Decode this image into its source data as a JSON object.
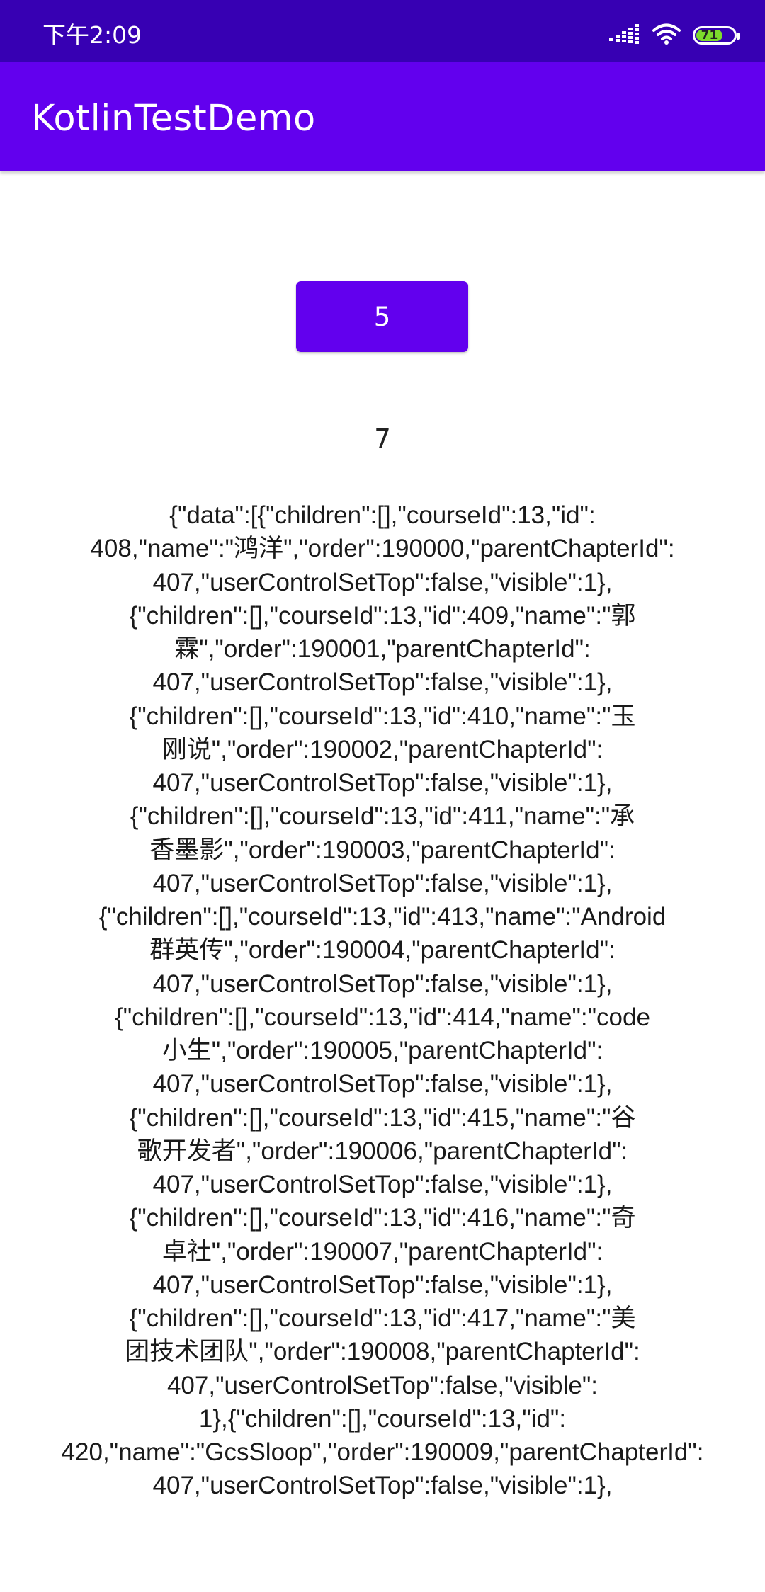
{
  "status_bar": {
    "time": "下午2:09",
    "battery_level": "71",
    "icons": [
      "signal-icon",
      "wifi-icon",
      "battery-icon"
    ]
  },
  "app_bar": {
    "title": "KotlinTestDemo",
    "color": "#6200EE"
  },
  "button": {
    "label": "5"
  },
  "counter": {
    "value": "7"
  },
  "json_lines": [
    "{\"data\":[{\"children\":[],\"courseId\":13,\"id\":",
    "408,\"name\":\"鸿洋\",\"order\":190000,\"parentChapterId\":",
    "407,\"userControlSetTop\":false,\"visible\":1},",
    "{\"children\":[],\"courseId\":13,\"id\":409,\"name\":\"郭",
    "霖\",\"order\":190001,\"parentChapterId\":",
    "407,\"userControlSetTop\":false,\"visible\":1},",
    "{\"children\":[],\"courseId\":13,\"id\":410,\"name\":\"玉",
    "刚说\",\"order\":190002,\"parentChapterId\":",
    "407,\"userControlSetTop\":false,\"visible\":1},",
    "{\"children\":[],\"courseId\":13,\"id\":411,\"name\":\"承",
    "香墨影\",\"order\":190003,\"parentChapterId\":",
    "407,\"userControlSetTop\":false,\"visible\":1},",
    "{\"children\":[],\"courseId\":13,\"id\":413,\"name\":\"Android",
    "群英传\",\"order\":190004,\"parentChapterId\":",
    "407,\"userControlSetTop\":false,\"visible\":1},",
    "{\"children\":[],\"courseId\":13,\"id\":414,\"name\":\"code",
    "小生\",\"order\":190005,\"parentChapterId\":",
    "407,\"userControlSetTop\":false,\"visible\":1},",
    "{\"children\":[],\"courseId\":13,\"id\":415,\"name\":\"谷",
    "歌开发者\",\"order\":190006,\"parentChapterId\":",
    "407,\"userControlSetTop\":false,\"visible\":1},",
    "{\"children\":[],\"courseId\":13,\"id\":416,\"name\":\"奇",
    "卓社\",\"order\":190007,\"parentChapterId\":",
    "407,\"userControlSetTop\":false,\"visible\":1},",
    "{\"children\":[],\"courseId\":13,\"id\":417,\"name\":\"美",
    "团技术团队\",\"order\":190008,\"parentChapterId\":",
    "407,\"userControlSetTop\":false,\"visible\":",
    "1},{\"children\":[],\"courseId\":13,\"id\":",
    "420,\"name\":\"GcsSloop\",\"order\":190009,\"parentChapterId\":",
    "407,\"userControlSetTop\":false,\"visible\":1},"
  ]
}
